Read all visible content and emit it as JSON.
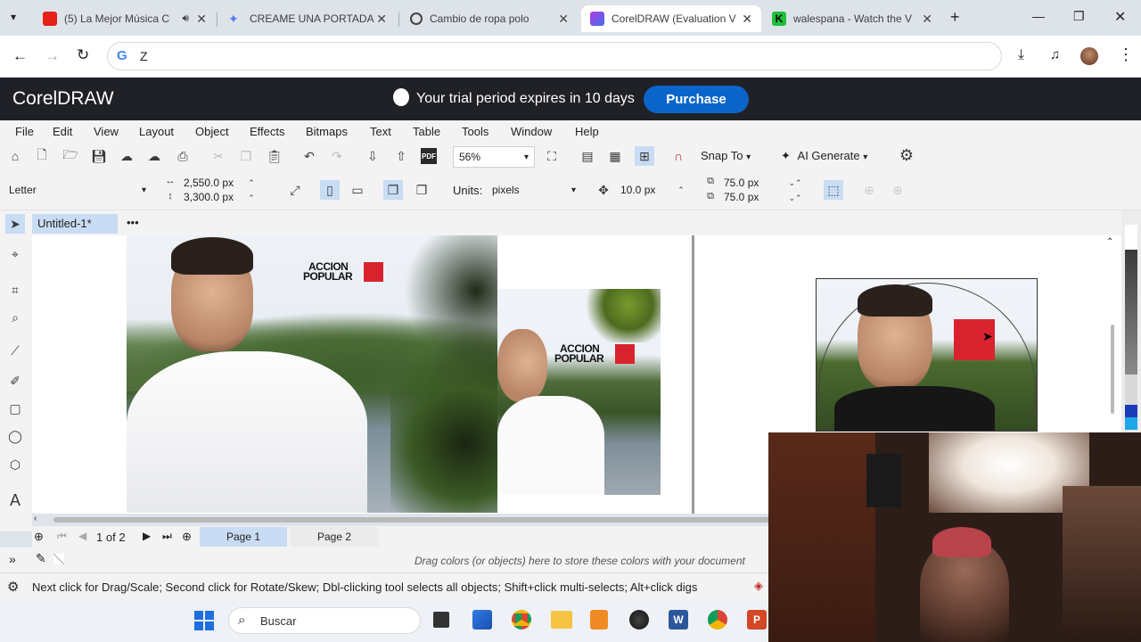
{
  "browser": {
    "tabs": [
      {
        "title": "(5) La Mejor Música C",
        "favicon_color": "#e62117"
      },
      {
        "title": "CREAME UNA PORTADA",
        "favicon_color": "#4f7df0"
      },
      {
        "title": "Cambio de ropa polo",
        "favicon_color": "#444444"
      },
      {
        "title": "CorelDRAW (Evaluation V",
        "favicon_color": "#7a3fd6"
      },
      {
        "title": "walespana - Watch the V",
        "favicon_color": "#1fbf3a"
      }
    ],
    "address": "Z"
  },
  "app": {
    "name": "CorelDRAW",
    "trial_text": "Your trial period expires in 10 days",
    "purchase_label": "Purchase"
  },
  "menu": [
    "File",
    "Edit",
    "View",
    "Layout",
    "Object",
    "Effects",
    "Bitmaps",
    "Text",
    "Table",
    "Tools",
    "Window",
    "Help"
  ],
  "toolbar": {
    "zoom": "56%",
    "snap_label": "Snap To",
    "ai_label": "AI Generate"
  },
  "propbar": {
    "page_size": "Letter",
    "width": "2,550.0 px",
    "height": "3,300.0 px",
    "units_label": "Units:",
    "units": "pixels",
    "nudge": "10.0 px",
    "dup_x": "75.0 px",
    "dup_y": "75.0 px"
  },
  "document": {
    "tab": "Untitled-1*"
  },
  "canvas": {
    "logo_line1": "ACCION",
    "logo_line2": "POPULAR"
  },
  "pages": {
    "current": "1",
    "of": "of",
    "total": "2",
    "page1": "Page 1",
    "page2": "Page 2"
  },
  "colorbar_hint": "Drag colors (or objects) here to store these colors with your document",
  "status_text": "Next click for Drag/Scale; Second click for Rotate/Skew; Dbl-clicking tool selects all objects; Shift+click multi-selects; Alt+click digs",
  "taskbar": {
    "search_placeholder": "Buscar"
  }
}
